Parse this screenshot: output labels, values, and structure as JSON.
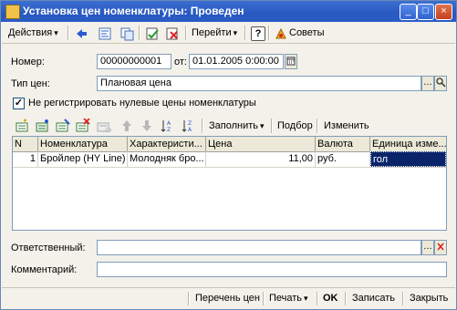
{
  "window": {
    "title": "Установка цен номенклатуры: Проведен",
    "controls": [
      "_",
      "□",
      "×"
    ]
  },
  "toolbar": {
    "actions_label": "Действия",
    "goto_label": "Перейти",
    "help_label": "?",
    "tips_label": "Советы"
  },
  "form": {
    "number_label": "Номер:",
    "number_value": "00000000001",
    "date_label": "от:",
    "date_value": "01.01.2005  0:00:00",
    "price_type_label": "Тип цен:",
    "price_type_value": "Плановая цена",
    "dont_register_label": "Не регистрировать нулевые цены номенклатуры",
    "dont_register_checked": true,
    "responsible_label": "Ответственный:",
    "responsible_value": "",
    "comment_label": "Комментарий:",
    "comment_value": ""
  },
  "grid_toolbar": {
    "fill_label": "Заполнить",
    "select_label": "Подбор",
    "change_label": "Изменить"
  },
  "grid": {
    "columns": [
      "N",
      "Номенклатура",
      "Характеристи...",
      "Цена",
      "Валюта",
      "Единица изме..."
    ],
    "rows": [
      {
        "n": "1",
        "item": "Бройлер (HY Line)",
        "characteristic": "Молодняк бро...",
        "price": "11,00",
        "currency": "руб.",
        "unit": "гол"
      }
    ]
  },
  "bottom": {
    "price_list_label": "Перечень цен",
    "print_label": "Печать",
    "ok_label": "OK",
    "save_label": "Записать",
    "close_label": "Закрыть"
  }
}
